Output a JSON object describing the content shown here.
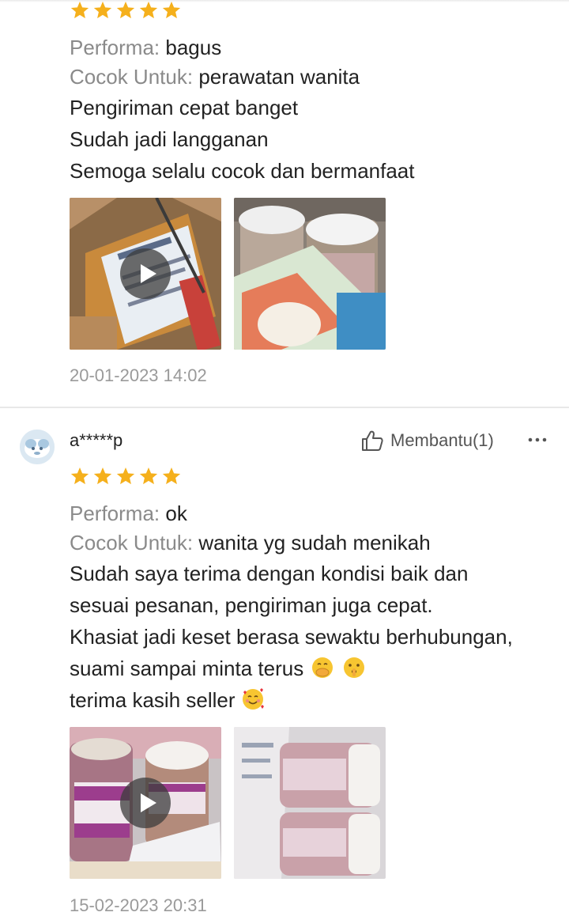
{
  "colors": {
    "star": "#f5b01c",
    "text_primary": "#222222",
    "text_label": "#8a8a8a",
    "text_date": "#9a9a9a",
    "divider": "#e8e8e8"
  },
  "reviews": [
    {
      "rating": 5,
      "performa_label": "Performa:",
      "performa_value": "bagus",
      "cocok_label": "Cocok Untuk:",
      "cocok_value": "perawatan wanita",
      "body_lines": [
        "Pengiriman cepat banget",
        "Sudah jadi langganan",
        "Semoga selalu cocok dan bermanfaat"
      ],
      "media": [
        {
          "kind": "video",
          "icon": "play-icon"
        },
        {
          "kind": "image"
        }
      ],
      "date": "20-01-2023 14:02"
    },
    {
      "rating": 5,
      "username": "a*****p",
      "helpful_label": "Membantu(1)",
      "helpful_icon": "thumbs-up-icon",
      "more_icon": "more-options-icon",
      "performa_label": "Performa:",
      "performa_value": "ok",
      "cocok_label": "Cocok Untuk:",
      "cocok_value": "wanita yg sudah menikah",
      "body_lines": [
        "Sudah saya terima dengan kondisi baik dan",
        "sesuai pesanan, pengiriman juga cepat.",
        "Khasiat jadi keset berasa sewaktu berhubungan,",
        "suami sampai minta terus",
        "terima kasih seller"
      ],
      "emojis": [
        "face-with-hand-over-mouth-emoji",
        "shushing-face-emoji",
        "smiling-face-with-hearts-emoji"
      ],
      "media": [
        {
          "kind": "video",
          "icon": "play-icon"
        },
        {
          "kind": "image"
        }
      ],
      "date": "15-02-2023 20:31"
    }
  ]
}
